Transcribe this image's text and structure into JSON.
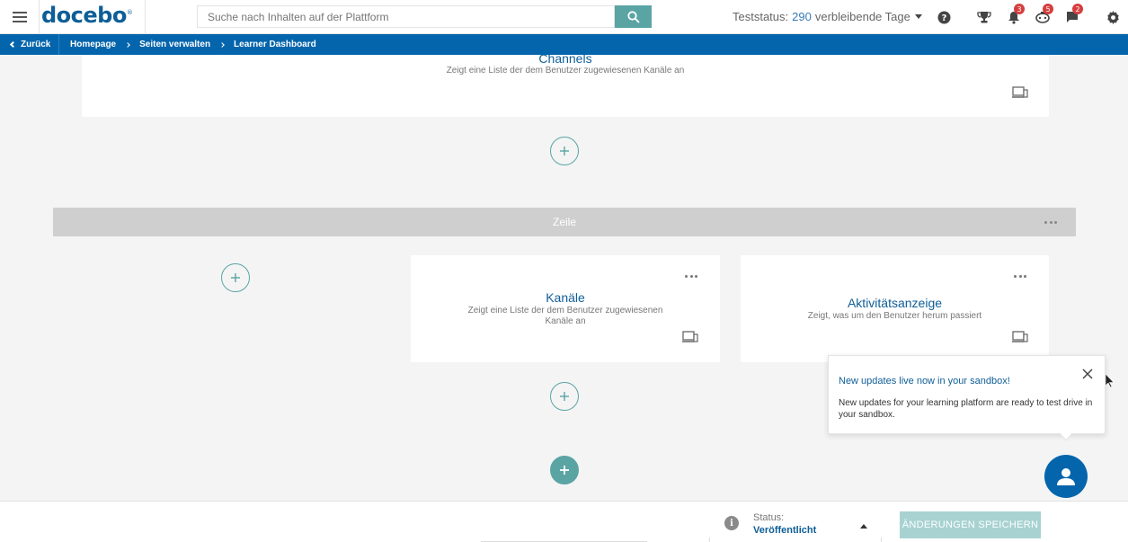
{
  "header": {
    "logo": "docebo",
    "search_placeholder": "Suche nach Inhalten auf der Plattform",
    "trial_prefix": "Teststatus:",
    "trial_days": "290",
    "trial_suffix": "verbleibende Tage",
    "notifications_count": "3",
    "gamification_count": "5",
    "messages_count": "2"
  },
  "breadcrumb": {
    "back_label": "Zurück",
    "items": [
      "Homepage",
      "Seiten verwalten",
      "Learner Dashboard"
    ]
  },
  "widgets": {
    "channels_top": {
      "title": "Channels",
      "description": "Zeigt eine Liste der dem Benutzer zugewiesenen Kanäle an"
    },
    "row_label": "Zeile",
    "kanaele": {
      "title": "Kanäle",
      "description_line1": "Zeigt eine Liste der dem Benutzer zugewiesenen",
      "description_line2": "Kanäle an"
    },
    "aktivitaet": {
      "title": "Aktivitätsanzeige",
      "description": "Zeigt, was um den Benutzer herum passiert"
    }
  },
  "popup": {
    "title": "New updates live now in your sandbox!",
    "text": "New updates for your learning platform are ready to test drive in your sandbox."
  },
  "footer": {
    "status_label": "Status:",
    "status_value": "Veröffentlicht",
    "save_label": "ÄNDERUNGEN SPEICHERN"
  },
  "colors": {
    "brand_blue": "#0465ac",
    "teal": "#5ba4a4",
    "badge_red": "#d63e3e"
  }
}
